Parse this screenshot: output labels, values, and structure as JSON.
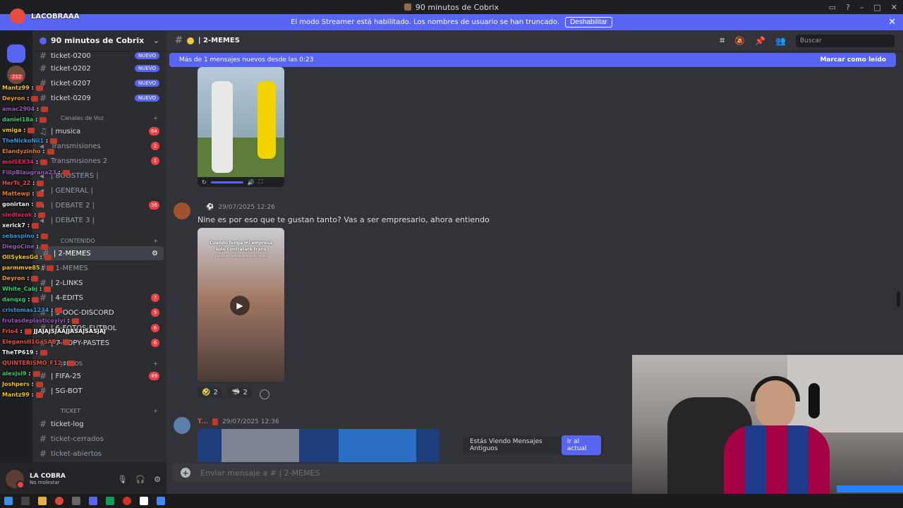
{
  "window": {
    "title": "90 minutos de Cobrix"
  },
  "streamer_banner": {
    "text": "El modo Streamer está habilitado. Los nombres de usuario se han truncado.",
    "button": "Deshabilitar"
  },
  "overlay": {
    "channel": "LACOBRAAA",
    "chat_users": [
      {
        "name": "Mantz99",
        "color": "#f1c40f"
      },
      {
        "name": "Deyron",
        "color": "#f39c12"
      },
      {
        "name": "amac2904",
        "color": "#9b59b6"
      },
      {
        "name": "daniel18a",
        "color": "#2ecc71"
      },
      {
        "name": "vmiga",
        "color": "#f1c40f"
      },
      {
        "name": "TheNickoNii1",
        "color": "#3498db"
      },
      {
        "name": "Elandyzinho",
        "color": "#e67e22"
      },
      {
        "name": "moiSEX34",
        "color": "#e91e63"
      },
      {
        "name": "FilipBlaugrana23",
        "color": "#9b59b6"
      },
      {
        "name": "HerTs_22",
        "color": "#e74c3c"
      },
      {
        "name": "Mattewp",
        "color": "#e67e22"
      },
      {
        "name": "gonirtan",
        "color": "#ecf0f1"
      },
      {
        "name": "sledlazok",
        "color": "#e91e63"
      },
      {
        "name": "xerick7",
        "color": "#ecf0f1"
      },
      {
        "name": "sebaspino",
        "color": "#3498db"
      },
      {
        "name": "DiegoCine",
        "color": "#9b59b6"
      },
      {
        "name": "OliSykesGd",
        "color": "#f1c40f"
      },
      {
        "name": "parmmve85",
        "color": "#f1c40f"
      },
      {
        "name": "Deyron",
        "color": "#f39c12"
      },
      {
        "name": "White_Cabj",
        "color": "#2ecc71"
      },
      {
        "name": "danqxg",
        "color": "#2ecc71"
      },
      {
        "name": "cristomas1234",
        "color": "#3498db"
      },
      {
        "name": "frutasdeplasticoyiyi",
        "color": "#9b59b6"
      },
      {
        "name": "Frio4",
        "color": "#e74c3c"
      },
      {
        "name": "ElegansII1GaSAB",
        "color": "#e74c3c"
      },
      {
        "name": "TheTP619",
        "color": "#ecf0f1"
      },
      {
        "name": "QUINTERISMO_F12",
        "color": "#e74c3c"
      },
      {
        "name": "alexjsl9",
        "color": "#2ecc71"
      },
      {
        "name": "Joshpers",
        "color": "#f1c40f"
      },
      {
        "name": "Mantz99",
        "color": "#f1c40f"
      }
    ],
    "chat_message": "JJAJAJSJAAJJASAJSASJAJ"
  },
  "sidebar": {
    "guild_name": "90 minutos de Cobrix",
    "new_label": "NUEVO",
    "tickets_top": [
      "ticket-0200",
      "ticket-0202",
      "ticket-0207",
      "ticket-0209"
    ],
    "voice_category": "Canales de Voz",
    "voice": [
      {
        "name": "| musica",
        "count": "64"
      },
      {
        "name": "Transmisiones",
        "count": "2"
      },
      {
        "name": "Transmisiones 2",
        "count": "1"
      },
      {
        "name": "| BOOSTERS |",
        "count": ""
      },
      {
        "name": "| GENERAL |",
        "count": ""
      },
      {
        "name": "| DEBATE 2 |",
        "count": "36"
      },
      {
        "name": "| DEBATE 3 |",
        "count": ""
      }
    ],
    "content_category": "CONTENIDO",
    "content": [
      {
        "name": "| 2-MEMES",
        "count": ""
      },
      {
        "name": "| 1-MEMES",
        "count": ""
      },
      {
        "name": "| 2-LINKS",
        "count": ""
      },
      {
        "name": "| 4-EDITS",
        "count": "7"
      },
      {
        "name": "| 5-OOC-DISCORD",
        "count": "5"
      },
      {
        "name": "| 6-FOTOS-FUTBOL",
        "count": "6"
      },
      {
        "name": "| 7-COPY-PASTES",
        "count": "6"
      }
    ],
    "games_category": "JUEGOS",
    "games": [
      {
        "name": "| FIFA-25",
        "count": "49"
      },
      {
        "name": "| SG-BOT",
        "count": ""
      }
    ],
    "ticket_category": "TICKET",
    "ticket_channels": [
      "ticket-log",
      "ticket-cerrados",
      "ticket-abiertos"
    ]
  },
  "user": {
    "name": "LA COBRA",
    "status": "No molestar"
  },
  "channel": {
    "name": "| 2-MEMES",
    "search_placeholder": "Buscar"
  },
  "new_messages": {
    "text": "Más de 1 mensajes nuevos desde las 0:23",
    "mark_read": "Marcar como leído"
  },
  "messages": [
    {
      "timestamp": "29/07/2025 12:26",
      "text": "Nine es por eso que te gustan tanto? Vas a ser empresario, ahora entiendo",
      "video_caption_1": "Cuando tenga mi empresa",
      "video_caption_2": "solo contrataré trans",
      "video_caption_3": "(fuerza de hombre, salario de mujer)",
      "reactions": [
        {
          "emoji": "🤣",
          "count": "2"
        },
        {
          "emoji": "🦈",
          "count": "2"
        }
      ]
    },
    {
      "author": "T...",
      "timestamp": "29/07/2025 12:36"
    }
  ],
  "old_messages": {
    "text": "Estás Viendo Mensajes Antiguos",
    "button": "Ir al actual"
  },
  "composer": {
    "placeholder": "Enviar mensaje a #",
    "channel": "| 2-MEMES"
  }
}
